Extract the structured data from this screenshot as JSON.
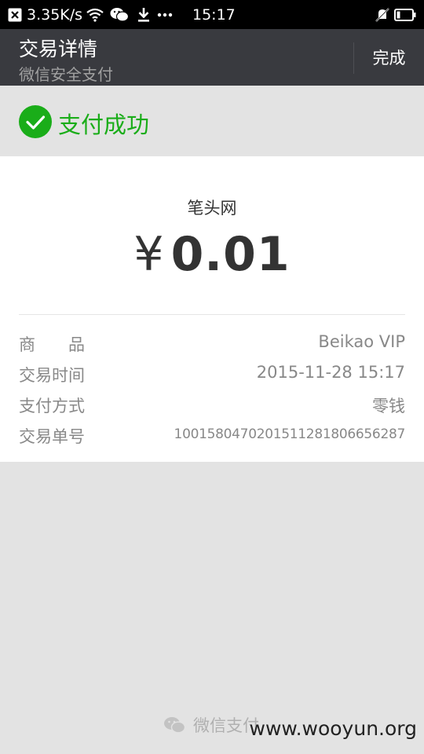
{
  "status_bar": {
    "notification_icon": "close-box-icon",
    "network_speed": "3.35K/s",
    "time": "15:17",
    "icons": [
      "wifi-icon",
      "wechat-icon",
      "download-icon",
      "more-dots-icon",
      "mute-icon",
      "battery-icon"
    ]
  },
  "header": {
    "title": "交易详情",
    "subtitle": "微信安全支付",
    "done_label": "完成",
    "background": "#393a3f"
  },
  "status": {
    "text": "支付成功",
    "icon": "check-circle-icon",
    "color": "#1aad19"
  },
  "payment": {
    "merchant": "笔头网",
    "currency_symbol": "¥",
    "amount": "0.01"
  },
  "details": [
    {
      "label": "商　　品",
      "value": "Beikao VIP"
    },
    {
      "label": "交易时间",
      "value": "2015-11-28 15:17"
    },
    {
      "label": "支付方式",
      "value": "零钱"
    },
    {
      "label": "交易单号",
      "value": "1001580470201511281806656287"
    }
  ],
  "footer": {
    "brand": "微信支付",
    "icon": "wechat-pay-icon"
  },
  "watermark": "www.wooyun.org"
}
